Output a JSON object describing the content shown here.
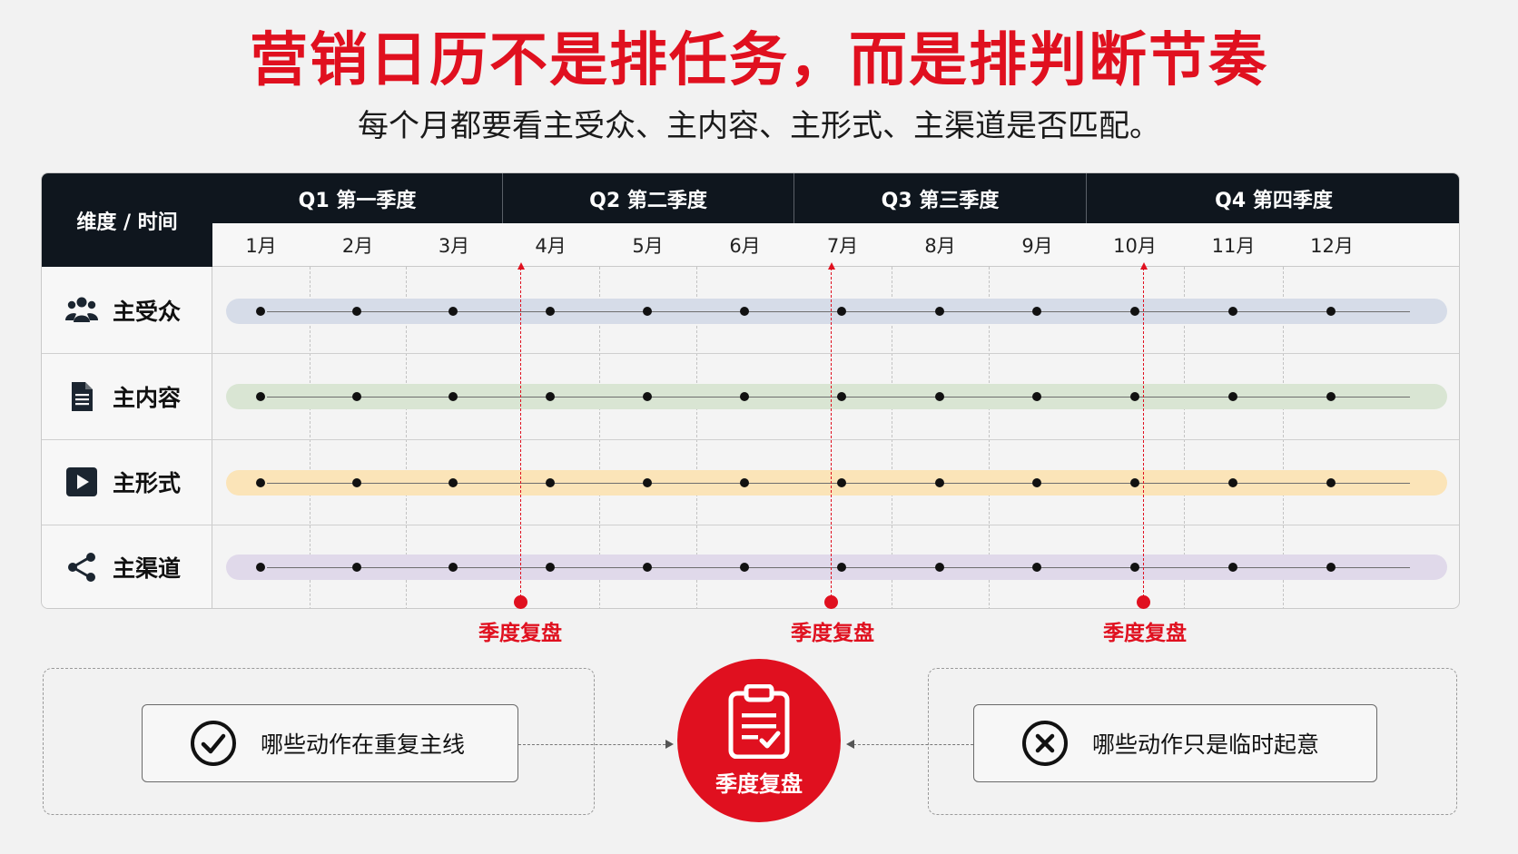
{
  "header": {
    "title": "营销日历不是排任务，而是排判断节奏",
    "subtitle": "每个月都要看主受众、主内容、主形式、主渠道是否匹配。"
  },
  "table": {
    "corner_label": "维度 / 时间",
    "quarters": [
      "Q1 第一季度",
      "Q2 第二季度",
      "Q3 第三季度",
      "Q4 第四季度"
    ],
    "months": [
      "1月",
      "2月",
      "3月",
      "4月",
      "5月",
      "6月",
      "7月",
      "8月",
      "9月",
      "10月",
      "11月",
      "12月"
    ],
    "rows": [
      {
        "label": "主受众",
        "icon": "people-icon",
        "color": "#d6dce8"
      },
      {
        "label": "主内容",
        "icon": "document-icon",
        "color": "#d9e5d3"
      },
      {
        "label": "主形式",
        "icon": "play-icon",
        "color": "#fbe4b8"
      },
      {
        "label": "主渠道",
        "icon": "share-icon",
        "color": "#e0d9ea"
      }
    ],
    "review_markers": [
      "季度复盘",
      "季度复盘",
      "季度复盘"
    ]
  },
  "bottom": {
    "left_pill": "哪些动作在重复主线",
    "right_pill": "哪些动作只是临时起意",
    "center_label": "季度复盘"
  },
  "colors": {
    "accent": "#e0101f",
    "header_bg": "#0f161e"
  }
}
